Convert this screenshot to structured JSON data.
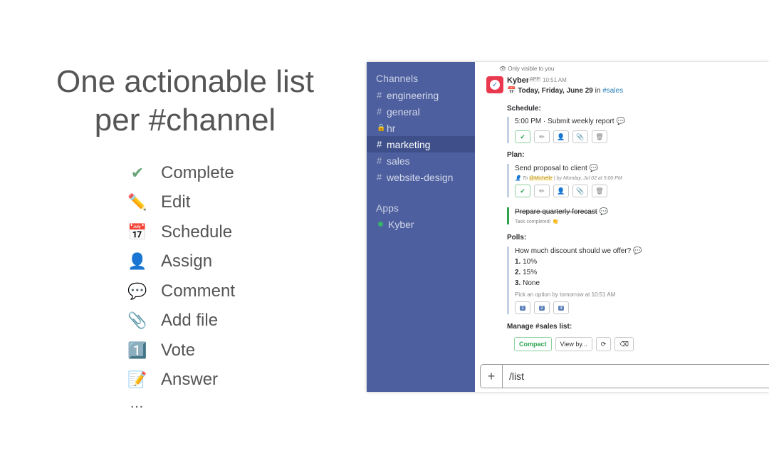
{
  "slide": {
    "title_line1": "One actionable list",
    "title_line2": "per #channel",
    "features": [
      {
        "icon": "check-icon",
        "glyph": "✔",
        "label": "Complete"
      },
      {
        "icon": "pencil-icon",
        "glyph": "✏️",
        "label": "Edit"
      },
      {
        "icon": "calendar-icon",
        "glyph": "📅",
        "label": "Schedule"
      },
      {
        "icon": "person-icon",
        "glyph": "👤",
        "label": "Assign"
      },
      {
        "icon": "speech-bubble-icon",
        "glyph": "💬",
        "label": "Comment"
      },
      {
        "icon": "paperclip-icon",
        "glyph": "📎",
        "label": "Add file"
      },
      {
        "icon": "keycap-one-icon",
        "glyph": "1️⃣",
        "label": "Vote"
      },
      {
        "icon": "memo-icon",
        "glyph": "📝",
        "label": "Answer"
      }
    ],
    "ellipsis": "…"
  },
  "sidebar": {
    "channels_heading": "Channels",
    "channels": [
      {
        "prefix": "#",
        "name": "engineering",
        "active": false
      },
      {
        "prefix": "#",
        "name": "general",
        "active": false
      },
      {
        "prefix": "🔒",
        "name": "hr",
        "active": false
      },
      {
        "prefix": "#",
        "name": "marketing",
        "active": true
      },
      {
        "prefix": "#",
        "name": "sales",
        "active": false
      },
      {
        "prefix": "#",
        "name": "website-design",
        "active": false
      }
    ],
    "apps_heading": "Apps",
    "apps": [
      {
        "name": "Kyber",
        "status_color": "#38b36f"
      }
    ]
  },
  "message": {
    "visibility_note": "Only visible to you",
    "sender": "Kyber",
    "badge": "APP",
    "time": "10:51 AM",
    "date_text": "Today, Friday, June 29",
    "date_in": "in",
    "channel": "#sales",
    "schedule_label": "Schedule:",
    "schedule_task": "5:00 PM · Submit weekly report",
    "plan_label": "Plan:",
    "plan_task": "Send proposal to client",
    "plan_sub_to": "To",
    "plan_sub_mention": "@Michelle",
    "plan_sub_rest": "| by Monday, Jul 02 at 5:00 PM",
    "done_task": "Prepare quarterly forecast",
    "done_note": "Task completed! 👏",
    "polls_label": "Polls:",
    "poll_question": "How much discount should we offer?",
    "poll_options": [
      {
        "num": "1.",
        "text": "10%"
      },
      {
        "num": "2.",
        "text": "15%"
      },
      {
        "num": "3.",
        "text": "None"
      }
    ],
    "poll_note": "Pick an option by tomorrow at 10:51 AM",
    "vote_buttons": [
      "1",
      "2",
      "3"
    ],
    "manage_label": "Manage #sales list:",
    "manage_buttons": [
      "Compact",
      "View by...",
      "⟳",
      "⌫"
    ]
  },
  "composer": {
    "plus": "+",
    "value": "/list"
  },
  "colors": {
    "sidebar_bg": "#4d5f9e",
    "sidebar_active": "#3e4f8a",
    "accent_green": "#2ea44f",
    "brand_red": "#e9394f"
  }
}
